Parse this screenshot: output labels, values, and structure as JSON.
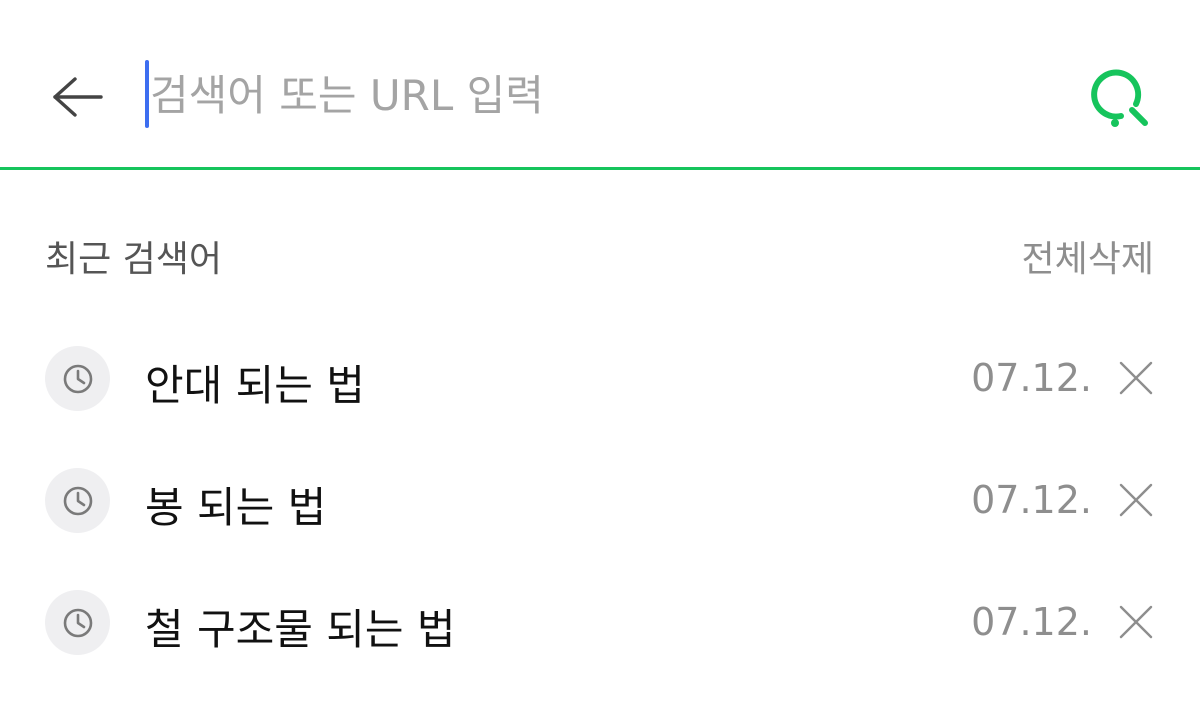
{
  "search": {
    "placeholder": "검색어 또는 URL 입력",
    "value": "",
    "accent_color": "#16c45c",
    "caret_color": "#3d6ef0",
    "back_icon": "arrow-left-icon",
    "submit_icon": "green-search-icon"
  },
  "recent": {
    "title": "최근 검색어",
    "clear_all_label": "전체삭제",
    "items": [
      {
        "text": "안대 되는 법",
        "date": "07.12.",
        "icon": "clock-icon",
        "delete_icon": "close-icon"
      },
      {
        "text": "봉 되는 법",
        "date": "07.12.",
        "icon": "clock-icon",
        "delete_icon": "close-icon"
      },
      {
        "text": "철 구조물 되는 법",
        "date": "07.12.",
        "icon": "clock-icon",
        "delete_icon": "close-icon"
      }
    ]
  }
}
